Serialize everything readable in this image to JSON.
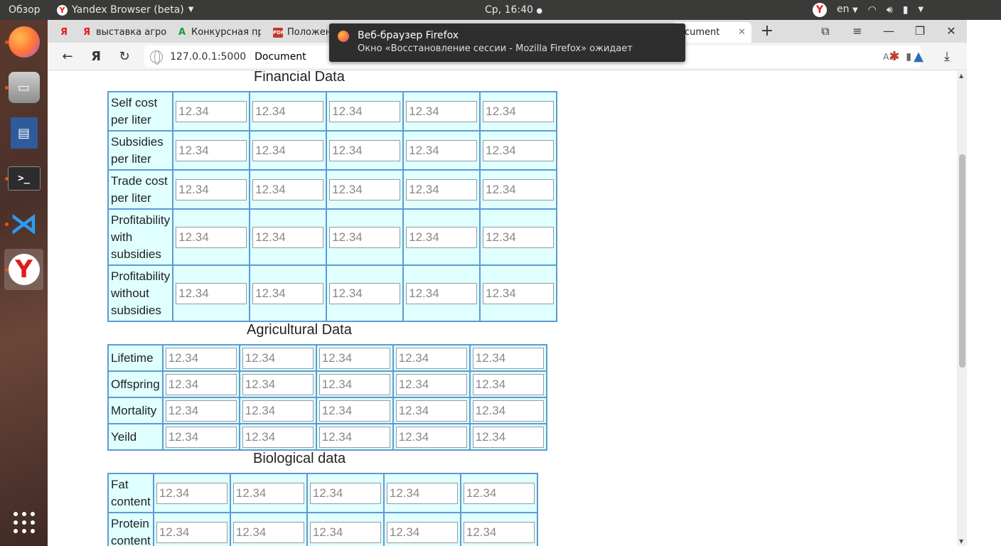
{
  "topbar": {
    "activities": "Обзор",
    "app_name": "Yandex Browser (beta)",
    "clock": "Ср, 16:40",
    "lang": "en"
  },
  "tabs": [
    {
      "label": "Я"
    },
    {
      "label": "выставка агрос"
    },
    {
      "label": "Конкурсная пр"
    },
    {
      "label": "Положен"
    },
    {
      "label": "ocument"
    }
  ],
  "address": {
    "host": "127.0.0.1:5000",
    "title": "Document"
  },
  "notification": {
    "title": "Веб-браузер Firefox",
    "body": "Окно «Восстановление сессии - Mozilla Firefox» ожидает"
  },
  "placeholder": "12.34",
  "financial": {
    "title": "Financial Data",
    "rows": [
      "Self cost per liter",
      "Subsidies per liter",
      "Trade cost per liter",
      "Profitability with subsidies",
      "Profitability without subsidies"
    ]
  },
  "agricultural": {
    "title": "Agricultural Data",
    "rows": [
      "Lifetime",
      "Offspring",
      "Mortality",
      "Yeild"
    ]
  },
  "biological": {
    "title": "Biological data",
    "rows": [
      "Fat content",
      "Protein content"
    ]
  },
  "colors": {
    "table_bg": "#e0ffff",
    "table_border": "#5b9bd5",
    "accent": "#e95420"
  }
}
